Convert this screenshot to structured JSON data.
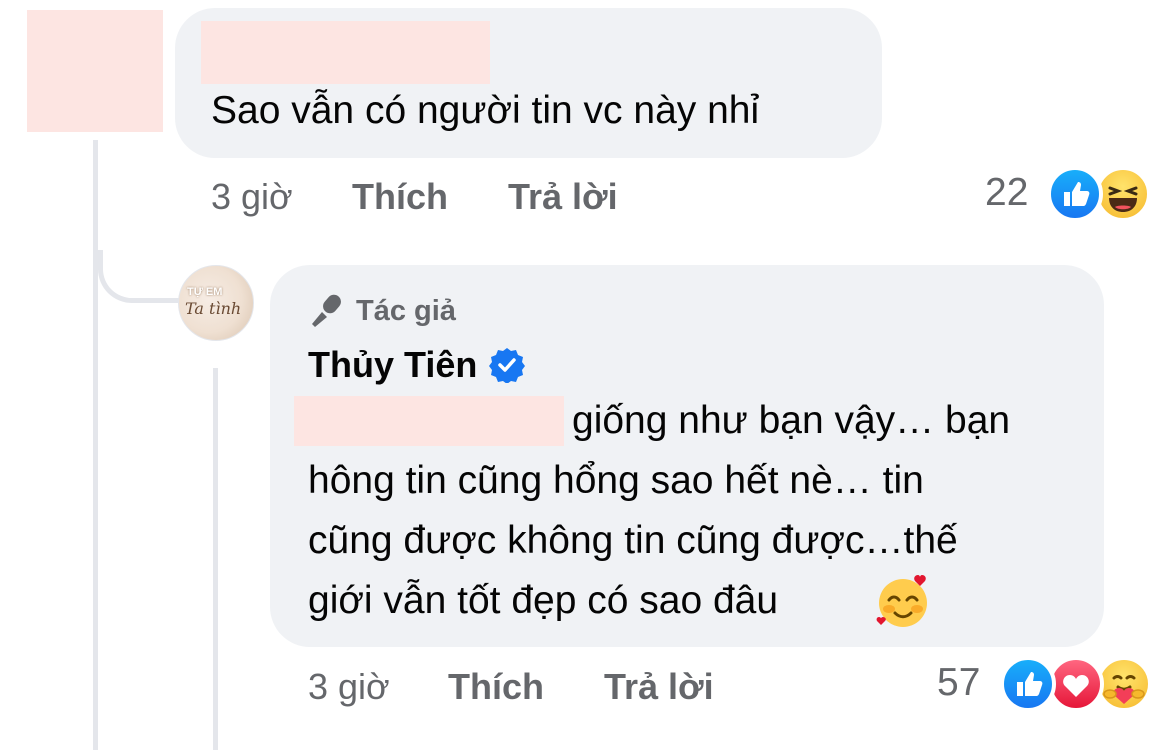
{
  "comment1": {
    "text": "Sao vẫn có người tin vc này nhỉ",
    "time": "3 giờ",
    "like_label": "Thích",
    "reply_label": "Trả lời",
    "reaction_count": "22",
    "reactions": [
      "like-icon",
      "haha-icon"
    ]
  },
  "reply1": {
    "badge_label": "Tác giả",
    "author_name": "Thủy Tiên",
    "text_line1": "giống như bạn vậy… bạn",
    "text_line2": "hông tin cũng hổng sao hết nè… tin",
    "text_line3": "cũng được không tin cũng được…thế",
    "text_line4": "giới vẫn tốt đẹp có sao đâu",
    "time": "3 giờ",
    "like_label": "Thích",
    "reply_label": "Trả lời",
    "reaction_count": "57",
    "reactions": [
      "like-icon",
      "love-icon",
      "care-icon"
    ],
    "avatar_text": "Tự Em Ta tình"
  },
  "colors": {
    "bubble": "#f0f2f5",
    "like_blue": "#1877f2",
    "love_red": "#f33e58",
    "meta_gray": "#65676b",
    "redaction": "#fde5e2"
  }
}
